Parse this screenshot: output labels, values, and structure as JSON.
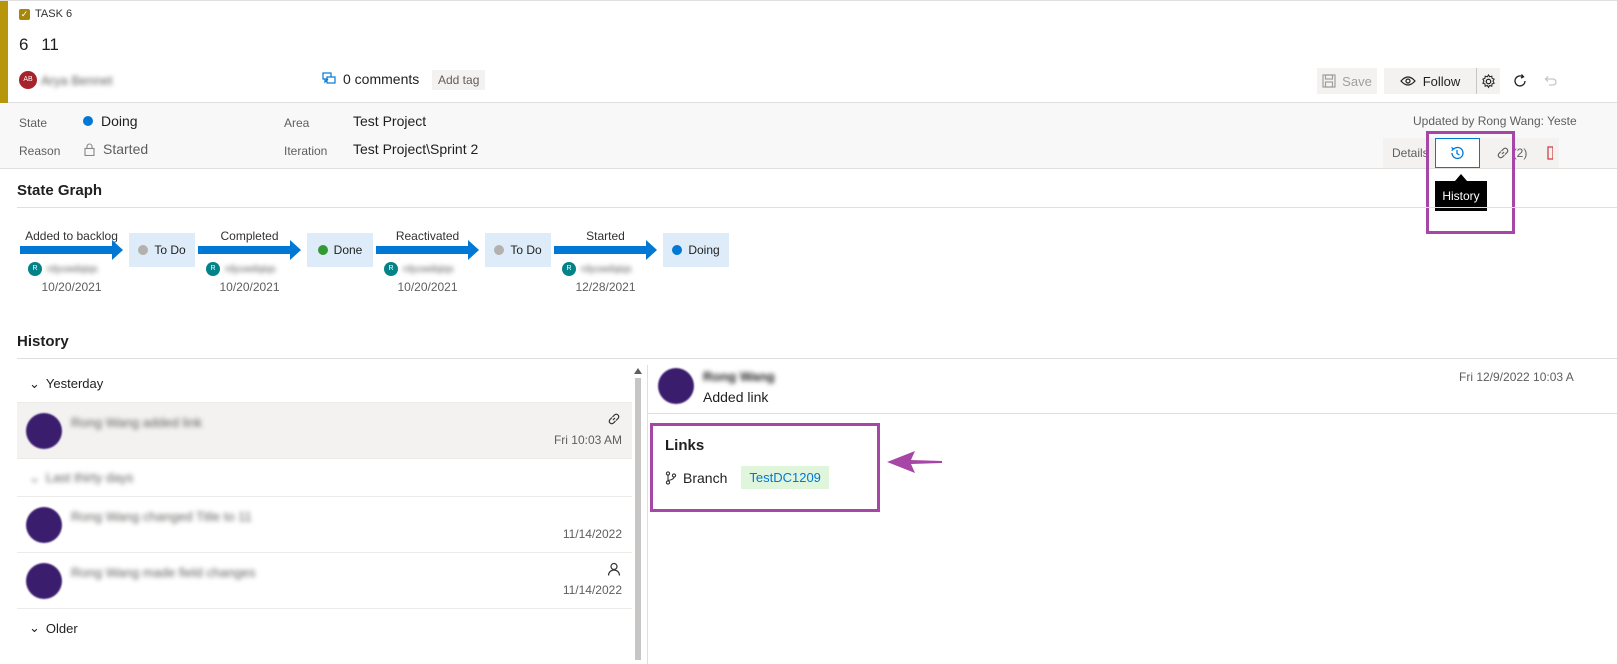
{
  "header": {
    "work_item_type": "TASK 6",
    "id": "6",
    "title": "11",
    "assignee_initials": "AB",
    "assignee_name": "Arya Bennet",
    "comments": "0 comments",
    "add_tag": "Add tag"
  },
  "toolbar": {
    "save_label": "Save",
    "follow_label": "Follow",
    "icons": [
      "save-icon",
      "eye-icon",
      "gear-icon",
      "refresh-icon",
      "undo-icon"
    ]
  },
  "fields": {
    "state_label": "State",
    "state_value": "Doing",
    "reason_label": "Reason",
    "reason_value": "Started",
    "area_label": "Area",
    "area_value": "Test Project",
    "iteration_label": "Iteration",
    "iteration_value": "Test Project\\Sprint 2",
    "updated_by": "Updated by Rong Wang: Yeste"
  },
  "page_tabs": {
    "details": "Details",
    "history_tooltip": "History",
    "links_count": "(2)"
  },
  "state_graph": {
    "title": "State Graph",
    "transitions": [
      {
        "label": "Added to backlog",
        "user_initial": "R",
        "user": "rdyuwdqiqs",
        "date": "10/20/2021",
        "to_state": "To Do",
        "to_color": "#b3b0ad"
      },
      {
        "label": "Completed",
        "user_initial": "R",
        "user": "rdyuwdqiqs",
        "date": "10/20/2021",
        "to_state": "Done",
        "to_color": "#339933"
      },
      {
        "label": "Reactivated",
        "user_initial": "R",
        "user": "rdyuwdqiqs",
        "date": "10/20/2021",
        "to_state": "To Do",
        "to_color": "#b3b0ad"
      },
      {
        "label": "Started",
        "user_initial": "R",
        "user": "rdyuwdqiqs",
        "date": "12/28/2021",
        "to_state": "Doing",
        "to_color": "#0078d4"
      }
    ]
  },
  "history": {
    "title": "History",
    "groups": [
      {
        "label": "Yesterday"
      },
      {
        "label": "Last thirty days"
      },
      {
        "label": "Older"
      }
    ],
    "items": [
      {
        "avatar": "RW",
        "text": "Rong Wang added link",
        "time": "Fri 10:03 AM",
        "icon": "link-icon"
      },
      {
        "avatar": "RW",
        "text": "Rong Wang changed Title to 11",
        "time": "11/14/2022",
        "icon": ""
      },
      {
        "avatar": "RW",
        "text": "Rong Wang made field changes",
        "time": "11/14/2022",
        "icon": "person-icon"
      }
    ],
    "detail": {
      "author": "Rong Wang",
      "action": "Added link",
      "date": "Fri 12/9/2022 10:03 A",
      "links_title": "Links",
      "link_type": "Branch",
      "link_value": "TestDC1209"
    }
  },
  "colors": {
    "accent": "#0078d4",
    "task_stripe": "#b8960c",
    "annotation": "#a646a6"
  }
}
